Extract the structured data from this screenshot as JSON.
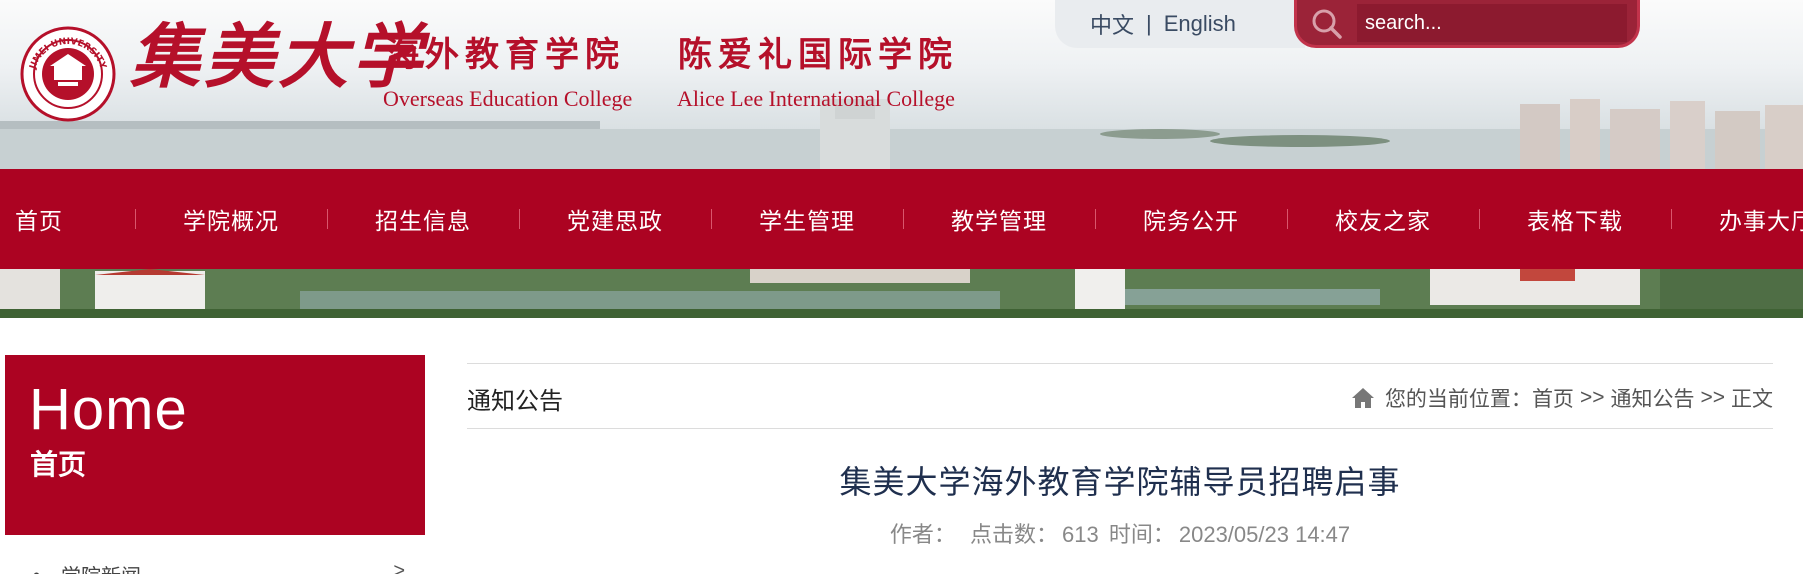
{
  "header": {
    "logo_cn": "集美大学",
    "seal_text": "JIMEI UNIVERSITY",
    "college_cn_1": "海外教育学院",
    "college_cn_2": "陈爱礼国际学院",
    "college_en_1": "Overseas Education College",
    "college_en_2": "Alice Lee International College",
    "lang_cn": "中文",
    "lang_sep": "|",
    "lang_en": "English",
    "search_placeholder": "search...",
    "search_icon": "search-icon"
  },
  "nav": {
    "items": [
      {
        "label": "首页"
      },
      {
        "label": "学院概况"
      },
      {
        "label": "招生信息"
      },
      {
        "label": "党建思政"
      },
      {
        "label": "学生管理"
      },
      {
        "label": "教学管理"
      },
      {
        "label": "院务公开"
      },
      {
        "label": "校友之家"
      },
      {
        "label": "表格下载"
      },
      {
        "label": "办事大厅"
      }
    ]
  },
  "sidebar": {
    "home_en": "Home",
    "home_cn": "首页",
    "list": [
      {
        "label": "学院新闻",
        "arrow": ">"
      }
    ]
  },
  "breadcrumb": {
    "section_title": "通知公告",
    "location_label": "您的当前位置：",
    "path": [
      "首页",
      "通知公告",
      "正文"
    ],
    "separator": ">>",
    "home_icon": "home-icon"
  },
  "article": {
    "title": "集美大学海外教育学院辅导员招聘启事",
    "author_label": "作者：",
    "author": "",
    "clicks_label": "点击数：",
    "clicks": "613",
    "time_label": "时间：",
    "time": "2023/05/23 14:47"
  },
  "colors": {
    "brand_red": "#ac0322",
    "title_navy": "#1f2f4e"
  }
}
